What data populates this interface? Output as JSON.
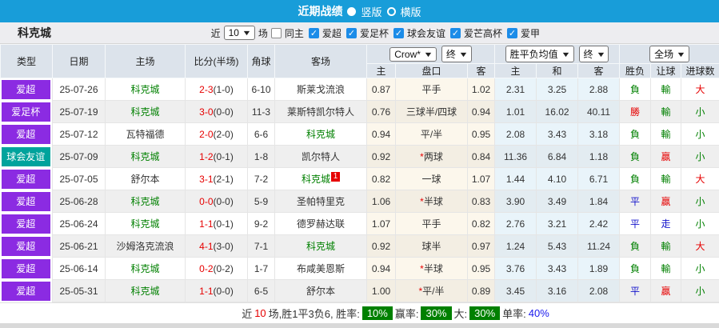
{
  "colors": {
    "purple": "#8b2be2",
    "teal": "#00a39c",
    "green": "#008000",
    "red": "#e60000",
    "blue": "#1414cc",
    "titlebar_blue": "#189dd9",
    "badge_green": "#008000"
  },
  "title_bar": {
    "title": "近期战绩",
    "radio_vertical": "竖版",
    "radio_horizontal": "横版"
  },
  "toolbar": {
    "team": "科克城",
    "near_label": "近",
    "match_count": "10",
    "games_label": "场",
    "same_home_label": "同主",
    "leagues": [
      "爱超",
      "爱足杯",
      "球会友谊",
      "爱芒高杯",
      "爱甲"
    ]
  },
  "table": {
    "dropdowns": {
      "bookmaker": "Crow*",
      "handicap_final": "终",
      "odds_type": "胜平负均值",
      "odds_final": "终",
      "scope": "全场"
    },
    "main_headers": [
      "类型",
      "日期",
      "主场",
      "比分(半场)",
      "角球",
      "客场"
    ],
    "sub_headers": [
      "主",
      "盘口",
      "客",
      "主",
      "和",
      "客",
      "胜负",
      "让球",
      "进球数"
    ],
    "rows": [
      {
        "type": {
          "label": "爱超",
          "bg": "purple"
        },
        "date": "25-07-26",
        "home": {
          "name": "科克城",
          "is_team": true
        },
        "score": {
          "full": "2-3",
          "half": "(1-0)"
        },
        "corner": "6-10",
        "away": {
          "name": "斯莱戈流浪",
          "is_team": false
        },
        "handicap": {
          "home": "0.87",
          "star": false,
          "line": "平手",
          "away": "1.02"
        },
        "odds": {
          "home": "2.31",
          "draw": "3.25",
          "away": "2.88"
        },
        "result": {
          "text": "負",
          "color": "green"
        },
        "handicap_result": {
          "text": "輸",
          "color": "green"
        },
        "goals": {
          "text": "大",
          "color": "red"
        }
      },
      {
        "type": {
          "label": "爱足杯",
          "bg": "purple"
        },
        "date": "25-07-19",
        "home": {
          "name": "科克城",
          "is_team": true
        },
        "score": {
          "full": "3-0",
          "half": "(0-0)"
        },
        "corner": "11-3",
        "away": {
          "name": "莱斯特凯尔特人",
          "is_team": false
        },
        "handicap": {
          "home": "0.76",
          "star": false,
          "line": "三球半/四球",
          "away": "0.94"
        },
        "odds": {
          "home": "1.01",
          "draw": "16.02",
          "away": "40.11"
        },
        "result": {
          "text": "勝",
          "color": "red"
        },
        "handicap_result": {
          "text": "輸",
          "color": "green"
        },
        "goals": {
          "text": "小",
          "color": "green"
        }
      },
      {
        "type": {
          "label": "爱超",
          "bg": "purple"
        },
        "date": "25-07-12",
        "home": {
          "name": "瓦特福德",
          "is_team": false
        },
        "score": {
          "full": "2-0",
          "half": "(2-0)"
        },
        "corner": "6-6",
        "away": {
          "name": "科克城",
          "is_team": true
        },
        "handicap": {
          "home": "0.94",
          "star": false,
          "line": "平/半",
          "away": "0.95"
        },
        "odds": {
          "home": "2.08",
          "draw": "3.43",
          "away": "3.18"
        },
        "result": {
          "text": "負",
          "color": "green"
        },
        "handicap_result": {
          "text": "輸",
          "color": "green"
        },
        "goals": {
          "text": "小",
          "color": "green"
        }
      },
      {
        "type": {
          "label": "球会友谊",
          "bg": "teal"
        },
        "date": "25-07-09",
        "home": {
          "name": "科克城",
          "is_team": true
        },
        "score": {
          "full": "1-2",
          "half": "(0-1)"
        },
        "corner": "1-8",
        "away": {
          "name": "凯尔特人",
          "is_team": false
        },
        "handicap": {
          "home": "0.92",
          "star": true,
          "line": "两球",
          "away": "0.84"
        },
        "odds": {
          "home": "11.36",
          "draw": "6.84",
          "away": "1.18"
        },
        "result": {
          "text": "負",
          "color": "green"
        },
        "handicap_result": {
          "text": "贏",
          "color": "red"
        },
        "goals": {
          "text": "小",
          "color": "green"
        }
      },
      {
        "type": {
          "label": "爱超",
          "bg": "purple"
        },
        "date": "25-07-05",
        "home": {
          "name": "舒尔本",
          "is_team": false
        },
        "score": {
          "full": "3-1",
          "half": "(2-1)"
        },
        "corner": "7-2",
        "away": {
          "name": "科克城",
          "is_team": true,
          "badge": "1"
        },
        "handicap": {
          "home": "0.82",
          "star": false,
          "line": "一球",
          "away": "1.07"
        },
        "odds": {
          "home": "1.44",
          "draw": "4.10",
          "away": "6.71"
        },
        "result": {
          "text": "負",
          "color": "green"
        },
        "handicap_result": {
          "text": "輸",
          "color": "green"
        },
        "goals": {
          "text": "大",
          "color": "red"
        }
      },
      {
        "type": {
          "label": "爱超",
          "bg": "purple"
        },
        "date": "25-06-28",
        "home": {
          "name": "科克城",
          "is_team": true
        },
        "score": {
          "full": "0-0",
          "half": "(0-0)"
        },
        "corner": "5-9",
        "away": {
          "name": "圣帕特里克",
          "is_team": false
        },
        "handicap": {
          "home": "1.06",
          "star": true,
          "line": "半球",
          "away": "0.83"
        },
        "odds": {
          "home": "3.90",
          "draw": "3.49",
          "away": "1.84"
        },
        "result": {
          "text": "平",
          "color": "blue"
        },
        "handicap_result": {
          "text": "贏",
          "color": "red"
        },
        "goals": {
          "text": "小",
          "color": "green"
        }
      },
      {
        "type": {
          "label": "爱超",
          "bg": "purple"
        },
        "date": "25-06-24",
        "home": {
          "name": "科克城",
          "is_team": true
        },
        "score": {
          "full": "1-1",
          "half": "(0-1)"
        },
        "corner": "9-2",
        "away": {
          "name": "德罗赫达联",
          "is_team": false
        },
        "handicap": {
          "home": "1.07",
          "star": false,
          "line": "平手",
          "away": "0.82"
        },
        "odds": {
          "home": "2.76",
          "draw": "3.21",
          "away": "2.42"
        },
        "result": {
          "text": "平",
          "color": "blue"
        },
        "handicap_result": {
          "text": "走",
          "color": "blue"
        },
        "goals": {
          "text": "小",
          "color": "green"
        }
      },
      {
        "type": {
          "label": "爱超",
          "bg": "purple"
        },
        "date": "25-06-21",
        "home": {
          "name": "沙姆洛克流浪",
          "is_team": false
        },
        "score": {
          "full": "4-1",
          "half": "(3-0)"
        },
        "corner": "7-1",
        "away": {
          "name": "科克城",
          "is_team": true
        },
        "handicap": {
          "home": "0.92",
          "star": false,
          "line": "球半",
          "away": "0.97"
        },
        "odds": {
          "home": "1.24",
          "draw": "5.43",
          "away": "11.24"
        },
        "result": {
          "text": "負",
          "color": "green"
        },
        "handicap_result": {
          "text": "輸",
          "color": "green"
        },
        "goals": {
          "text": "大",
          "color": "red"
        }
      },
      {
        "type": {
          "label": "爱超",
          "bg": "purple"
        },
        "date": "25-06-14",
        "home": {
          "name": "科克城",
          "is_team": true
        },
        "score": {
          "full": "0-2",
          "half": "(0-2)"
        },
        "corner": "1-7",
        "away": {
          "name": "布咸美恩斯",
          "is_team": false
        },
        "handicap": {
          "home": "0.94",
          "star": true,
          "line": "半球",
          "away": "0.95"
        },
        "odds": {
          "home": "3.76",
          "draw": "3.43",
          "away": "1.89"
        },
        "result": {
          "text": "負",
          "color": "green"
        },
        "handicap_result": {
          "text": "輸",
          "color": "green"
        },
        "goals": {
          "text": "小",
          "color": "green"
        }
      },
      {
        "type": {
          "label": "爱超",
          "bg": "purple"
        },
        "date": "25-05-31",
        "home": {
          "name": "科克城",
          "is_team": true
        },
        "score": {
          "full": "1-1",
          "half": "(0-0)"
        },
        "corner": "6-5",
        "away": {
          "name": "舒尔本",
          "is_team": false
        },
        "handicap": {
          "home": "1.00",
          "star": true,
          "line": "平/半",
          "away": "0.89"
        },
        "odds": {
          "home": "3.45",
          "draw": "3.16",
          "away": "2.08"
        },
        "result": {
          "text": "平",
          "color": "blue"
        },
        "handicap_result": {
          "text": "贏",
          "color": "red"
        },
        "goals": {
          "text": "小",
          "color": "green"
        }
      }
    ]
  },
  "footer": {
    "prefix": "近",
    "count": "10",
    "summary": "场,胜1平3负6, 胜率:",
    "win_rate": "10%",
    "handicap_label": "赢率:",
    "handicap_rate": "30%",
    "big_label": "大:",
    "big_rate": "30%",
    "single_label": "单率:",
    "single_rate": "40%"
  }
}
